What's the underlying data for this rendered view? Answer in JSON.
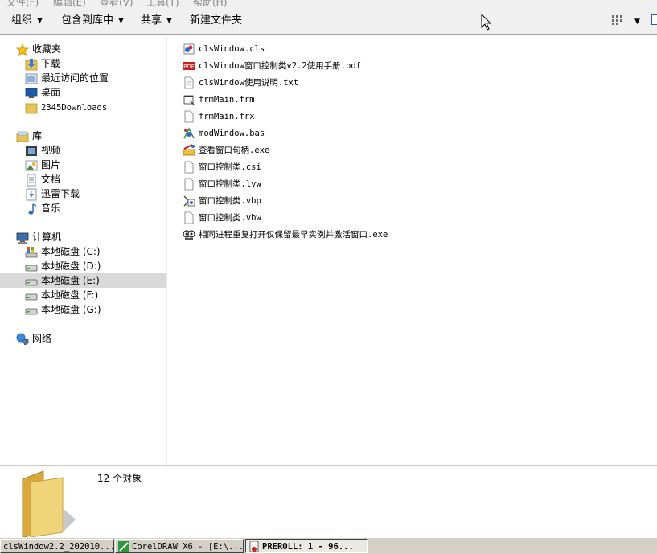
{
  "menu": [
    "文件(F)",
    "编辑(E)",
    "查看(V)",
    "工具(T)",
    "帮助(H)"
  ],
  "toolbar": {
    "organize": "组织",
    "include_in_library": "包含到库中",
    "share": "共享",
    "new_folder": "新建文件夹",
    "dropdown_arrow": "▼"
  },
  "nav": {
    "favorites": {
      "label": "收藏夹",
      "items": [
        "下载",
        "最近访问的位置",
        "桌面",
        "2345Downloads"
      ]
    },
    "libraries": {
      "label": "库",
      "items": [
        "视频",
        "图片",
        "文档",
        "迅雷下载",
        "音乐"
      ]
    },
    "computer": {
      "label": "计算机",
      "items": [
        "本地磁盘 (C:)",
        "本地磁盘 (D:)",
        "本地磁盘 (E:)",
        "本地磁盘 (F:)",
        "本地磁盘 (G:)"
      ],
      "selected_index": 2
    },
    "network": {
      "label": "网络"
    }
  },
  "files": [
    {
      "name": "clsWindow.cls",
      "icon": "vb-class-icon"
    },
    {
      "name": "clsWindow窗口控制类v2.2使用手册.pdf",
      "icon": "pdf-icon"
    },
    {
      "name": "clsWindow使用说明.txt",
      "icon": "text-file-icon"
    },
    {
      "name": "frmMain.frm",
      "icon": "vb-form-icon"
    },
    {
      "name": "frmMain.frx",
      "icon": "blank-file-icon"
    },
    {
      "name": "modWindow.bas",
      "icon": "vb-module-icon"
    },
    {
      "name": "查看窗口句柄.exe",
      "icon": "exe-tool-icon"
    },
    {
      "name": "窗口控制类.csi",
      "icon": "blank-file-icon"
    },
    {
      "name": "窗口控制类.lvw",
      "icon": "blank-file-icon"
    },
    {
      "name": "窗口控制类.vbp",
      "icon": "vb-project-icon"
    },
    {
      "name": "窗口控制类.vbw",
      "icon": "blank-file-icon"
    },
    {
      "name": "相同进程重复打开仅保留最早实例并激活窗口.exe",
      "icon": "exe-app-icon"
    }
  ],
  "details": {
    "count_text": "12 个对象"
  },
  "taskbar": [
    {
      "label": "clsWindow2.2_202010...",
      "active": false
    },
    {
      "label": "CorelDRAW X6 - [E:\\...",
      "active": false
    },
    {
      "label": "PREROLL: 1 - 96...",
      "active": true
    }
  ],
  "colors": {
    "selection": "#d9d9d9",
    "pane_bg": "#ffffff",
    "chrome_bg": "#f0f0f0",
    "folder": "#e8c25a"
  }
}
